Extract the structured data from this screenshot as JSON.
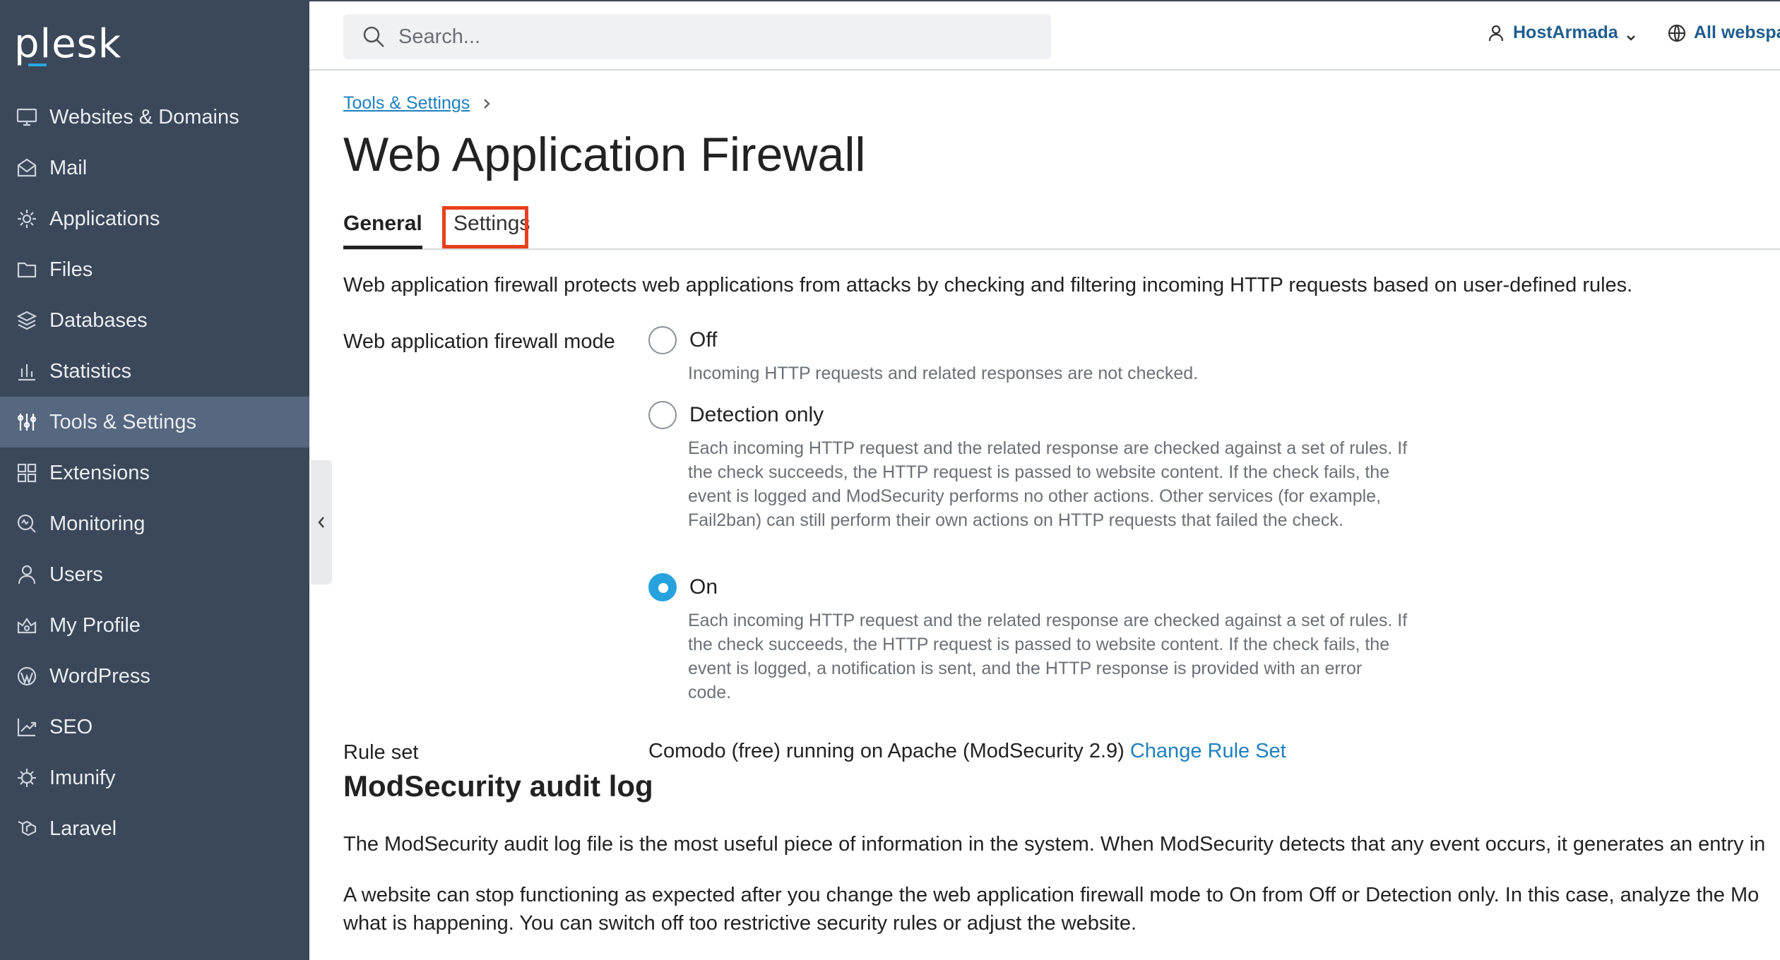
{
  "sidebar": {
    "logo": "plesk",
    "items": [
      {
        "label": "Websites & Domains",
        "icon": "monitor-icon"
      },
      {
        "label": "Mail",
        "icon": "mail-icon"
      },
      {
        "label": "Applications",
        "icon": "gear-icon"
      },
      {
        "label": "Files",
        "icon": "folder-icon"
      },
      {
        "label": "Databases",
        "icon": "database-icon"
      },
      {
        "label": "Statistics",
        "icon": "bar-chart-icon"
      },
      {
        "label": "Tools & Settings",
        "icon": "sliders-icon",
        "active": true
      },
      {
        "label": "Extensions",
        "icon": "extensions-icon"
      },
      {
        "label": "Monitoring",
        "icon": "monitoring-icon"
      },
      {
        "label": "Users",
        "icon": "user-icon"
      },
      {
        "label": "My Profile",
        "icon": "profile-icon"
      },
      {
        "label": "WordPress",
        "icon": "wordpress-icon"
      },
      {
        "label": "SEO",
        "icon": "seo-icon"
      },
      {
        "label": "Imunify",
        "icon": "imunify-icon"
      },
      {
        "label": "Laravel",
        "icon": "laravel-icon"
      }
    ]
  },
  "header": {
    "search_placeholder": "Search...",
    "user_name": "HostArmada",
    "webspaces": "All webspa"
  },
  "breadcrumb": {
    "label": "Tools & Settings"
  },
  "page": {
    "title": "Web Application Firewall",
    "tabs": {
      "general": "General",
      "settings": "Settings"
    },
    "description": "Web application firewall protects web applications from attacks by checking and filtering incoming HTTP requests based on user-defined rules.",
    "mode_label": "Web application firewall mode",
    "modes": {
      "off": {
        "label": "Off",
        "hint": "Incoming HTTP requests and related responses are not checked."
      },
      "detection": {
        "label": "Detection only",
        "hint": "Each incoming HTTP request and the related response are checked against a set of rules. If the check succeeds, the HTTP request is passed to website content. If the check fails, the event is logged and ModSecurity performs no other actions. Other services (for example, Fail2ban) can still perform their own actions on HTTP requests that failed the check."
      },
      "on": {
        "label": "On",
        "hint": "Each incoming HTTP request and the related response are checked against a set of rules. If the check succeeds, the HTTP request is passed to website content. If the check fails, the event is logged, a notification is sent, and the HTTP response is provided with an error code."
      },
      "selected": "on"
    },
    "rule_set_label": "Rule set",
    "rule_set_value": "Comodo (free) running on Apache (ModSecurity 2.9)",
    "change_rule_set": "Change Rule Set",
    "audit_title": "ModSecurity audit log",
    "audit_para1": "The ModSecurity audit log file is the most useful piece of information in the system. When ModSecurity detects that any event occurs, it generates an entry in",
    "audit_para2_line1": "A website can stop functioning as expected after you change the web application firewall mode to On from Off or Detection only. In this case, analyze the Mo",
    "audit_para2_line2": "what is happening. You can switch off too restrictive security rules or adjust the website."
  },
  "colors": {
    "sidebar_bg": "#3b4859",
    "sidebar_active": "#56677f",
    "link": "#1f80bf",
    "radio_checked": "#28a2df",
    "highlight": "#e8401e"
  }
}
